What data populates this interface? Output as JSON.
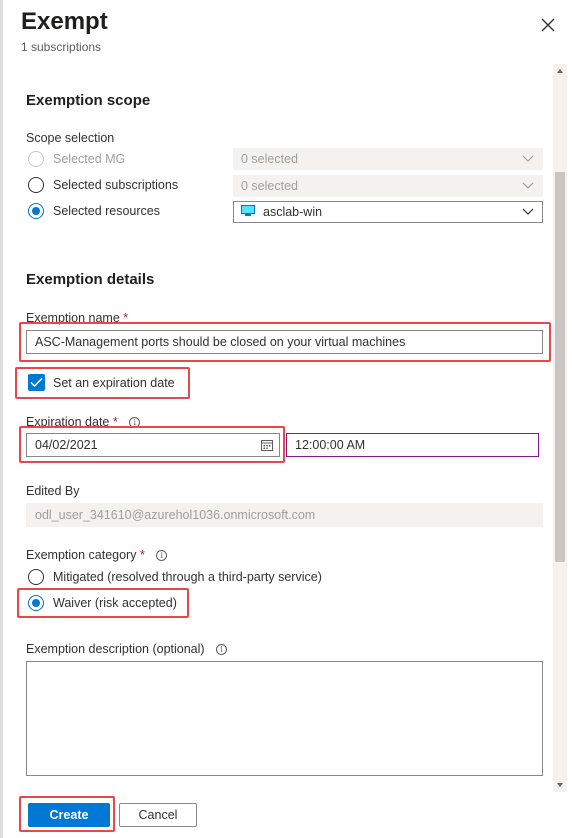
{
  "header": {
    "title": "Exempt",
    "subtitle": "1 subscriptions"
  },
  "scope": {
    "heading": "Exemption scope",
    "selection_label": "Scope selection",
    "options": [
      {
        "label": "Selected MG",
        "value": "0 selected",
        "state": "disabled"
      },
      {
        "label": "Selected subscriptions",
        "value": "0 selected",
        "state": "unchecked"
      },
      {
        "label": "Selected resources",
        "value": "asclab-win",
        "state": "checked"
      }
    ]
  },
  "details": {
    "heading": "Exemption details",
    "name_label": "Exemption name",
    "required_mark": "*",
    "name_value": "ASC-Management ports should be closed on your virtual machines",
    "expiration_checkbox_label": "Set an expiration date",
    "expiration_label": "Expiration date",
    "expiration_date": "04/02/2021",
    "expiration_time": "12:00:00 AM",
    "edited_by_label": "Edited By",
    "edited_by_value": "odl_user_341610@azurehol1036.onmicrosoft.com",
    "category_label": "Exemption category",
    "category_options": [
      {
        "label": "Mitigated (resolved through a third-party service)",
        "state": "unchecked"
      },
      {
        "label": "Waiver (risk accepted)",
        "state": "checked"
      }
    ],
    "description_label": "Exemption description (optional)",
    "description_value": ""
  },
  "footer": {
    "create_label": "Create",
    "cancel_label": "Cancel"
  },
  "icons": {
    "close": "close-icon",
    "info": "info-icon",
    "calendar": "calendar-icon",
    "chevron": "chevron-down-icon",
    "vm": "virtual-machine-icon"
  },
  "colors": {
    "accent": "#0078d4",
    "highlight": "#e8474c",
    "required": "#a4262c",
    "time_border": "#881798"
  }
}
